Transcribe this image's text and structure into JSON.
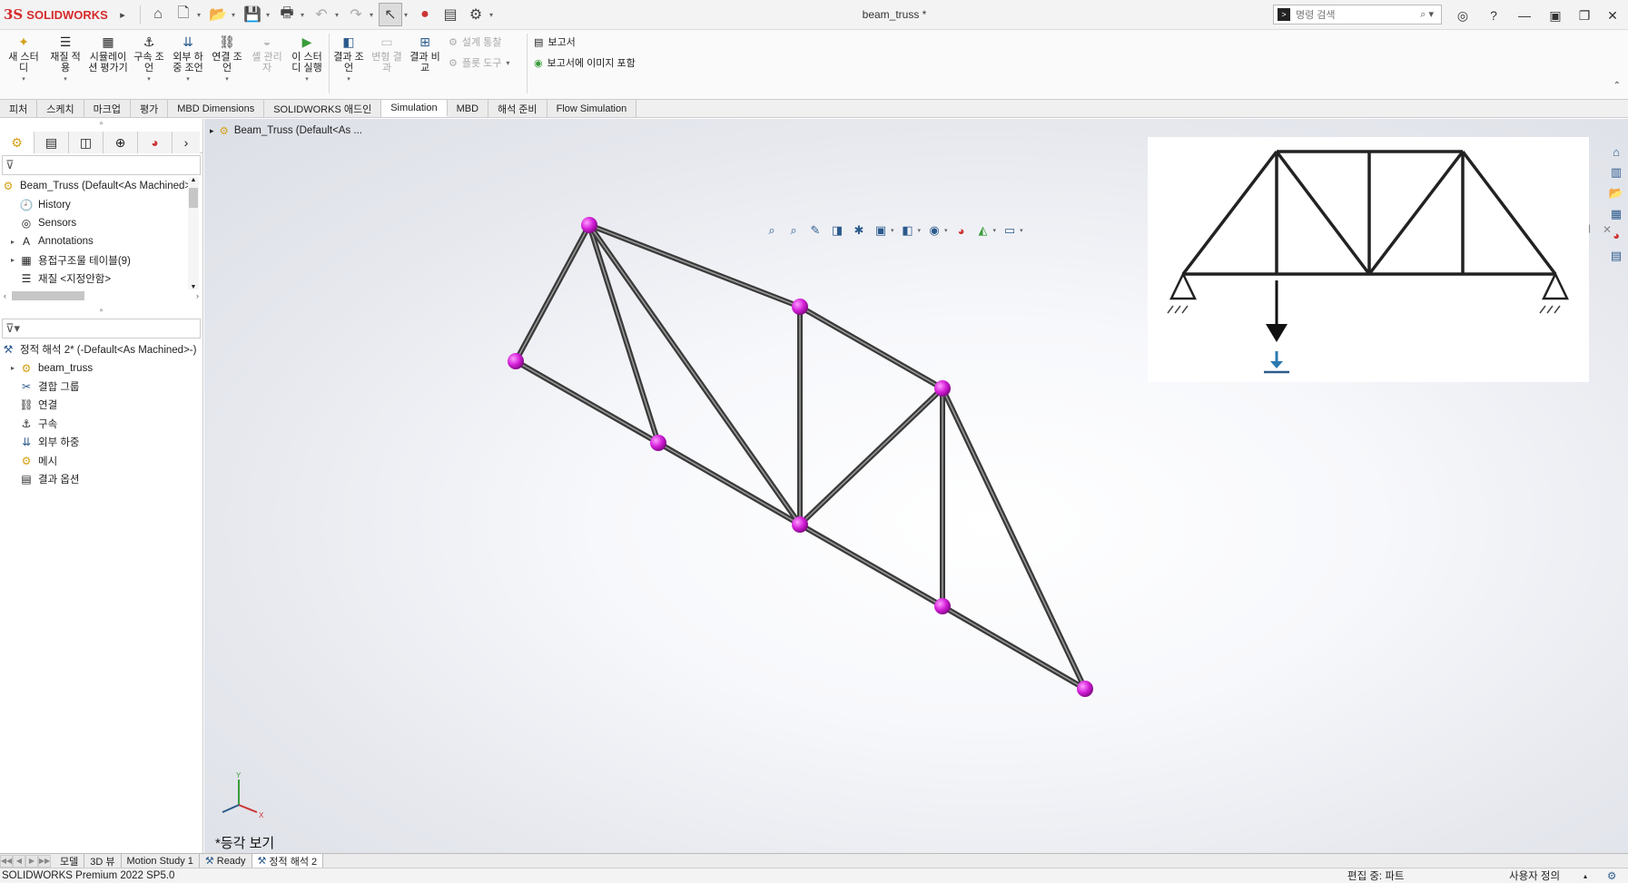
{
  "app": {
    "logo_mark": "3S",
    "logo_text": "SOLIDWORKS",
    "doc_title": "beam_truss *",
    "search_placeholder": "명령 검색"
  },
  "ribbon": {
    "buttons": [
      {
        "label": "새 스터디",
        "icon": "new-study-icon",
        "enabled": true,
        "dropdown": true
      },
      {
        "label": "재질 적용",
        "icon": "material-icon",
        "enabled": true,
        "dropdown": true
      },
      {
        "label": "시뮬레이션 평가기",
        "icon": "sim-evaluator-icon",
        "enabled": true,
        "dropdown": false
      },
      {
        "label": "구속 조언",
        "icon": "fixture-icon",
        "enabled": true,
        "dropdown": true
      },
      {
        "label": "외부 하중 조언",
        "icon": "external-load-icon",
        "enabled": true,
        "dropdown": true
      },
      {
        "label": "연결 조언",
        "icon": "connection-icon",
        "enabled": true,
        "dropdown": true
      },
      {
        "label": "셸 관리자",
        "icon": "shell-manager-icon",
        "enabled": false,
        "dropdown": false
      },
      {
        "label": "이 스터디 실행",
        "icon": "run-study-icon",
        "enabled": true,
        "dropdown": true
      },
      {
        "label": "결과 조언",
        "icon": "results-advisor-icon",
        "enabled": true,
        "dropdown": true
      },
      {
        "label": "변형 결과",
        "icon": "deformed-result-icon",
        "enabled": false,
        "dropdown": false
      },
      {
        "label": "결과 비교",
        "icon": "compare-results-icon",
        "enabled": true,
        "dropdown": false
      }
    ],
    "small_disabled": [
      "설계 통찰",
      "플롯 도구"
    ],
    "report_items": [
      "보고서",
      "보고서에 이미지 포함"
    ]
  },
  "tabs": [
    "피처",
    "스케치",
    "마크업",
    "평가",
    "MBD Dimensions",
    "SOLIDWORKS 애드인",
    "Simulation",
    "MBD",
    "해석 준비",
    "Flow Simulation"
  ],
  "active_tab": "Simulation",
  "feature_tree": {
    "root": "Beam_Truss (Default<As Machined>",
    "items": [
      {
        "label": "History",
        "icon": "history-icon",
        "expand": false
      },
      {
        "label": "Sensors",
        "icon": "sensors-icon",
        "expand": false
      },
      {
        "label": "Annotations",
        "icon": "annotations-icon",
        "expand": true
      },
      {
        "label": "용접구조물 테이블(9)",
        "icon": "weldment-table-icon",
        "expand": true
      },
      {
        "label": "재질 <지정안함>",
        "icon": "material-list-icon",
        "expand": false
      }
    ]
  },
  "sim_tree": {
    "root": "정적 해석 2* (-Default<As Machined>-)",
    "items": [
      {
        "label": "beam_truss",
        "icon": "part-icon",
        "expand": true
      },
      {
        "label": "결합 그룹",
        "icon": "connection-group-icon",
        "expand": false
      },
      {
        "label": "연결",
        "icon": "connections-icon",
        "expand": false
      },
      {
        "label": "구속",
        "icon": "fixtures-icon",
        "expand": false
      },
      {
        "label": "외부 하중",
        "icon": "external-loads-icon",
        "expand": false
      },
      {
        "label": "메시",
        "icon": "mesh-icon",
        "expand": false
      },
      {
        "label": "결과 옵션",
        "icon": "result-options-icon",
        "expand": false
      }
    ]
  },
  "viewport": {
    "tree_label": "Beam_Truss  (Default<As ...",
    "view_label": "*등각 보기",
    "triad": {
      "x": "X",
      "y": "Y"
    },
    "node_color": "#d41ed8",
    "beam_color": "#3a3a3a"
  },
  "bottom_tabs": [
    "모델",
    "3D 뷰",
    "Motion Study 1",
    "Ready",
    "정적 해석 2"
  ],
  "status": {
    "product": "SOLIDWORKS Premium 2022 SP5.0",
    "editing": "편집 중: 파트",
    "units": "사용자 정의"
  }
}
